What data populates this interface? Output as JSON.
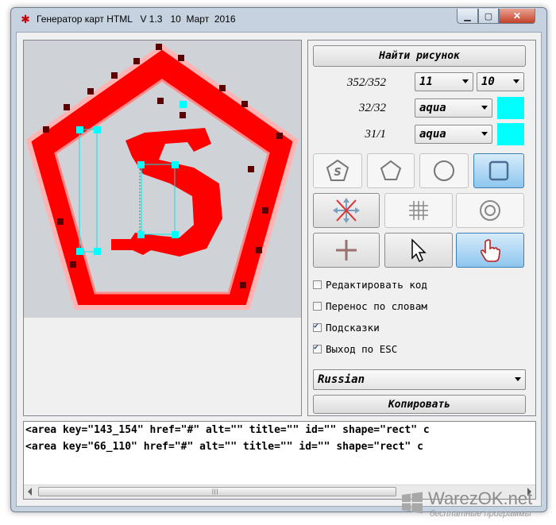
{
  "window": {
    "title": "Генератор карт HTML   V 1.3   10  Март  2016",
    "minimize_glyph": "▁",
    "maximize_glyph": "▢",
    "close_glyph": "✕"
  },
  "toolbar": {
    "find_image_label": "Найти рисунок",
    "copy_label": "Копировать"
  },
  "info_rows": [
    {
      "label": "352/352",
      "combo1": "11",
      "combo2": "10"
    },
    {
      "label": "32/32",
      "color_name": "aqua",
      "swatch_color": "#00ffff"
    },
    {
      "label": "31/1",
      "color_name": "aqua",
      "swatch_color": "#00ffff"
    }
  ],
  "checkboxes": [
    {
      "label": "Редактировать код",
      "checked": false
    },
    {
      "label": "Перенос по словам",
      "checked": false
    },
    {
      "label": "Подсказки",
      "checked": true
    },
    {
      "label": "Выход по ESC",
      "checked": true
    }
  ],
  "language": "Russian",
  "code_lines": [
    "<area key=\"143_154\" href=\"#\" alt=\"\" title=\"\" id=\"\" shape=\"rect\" c",
    "<area key=\"66_110\" href=\"#\" alt=\"\" title=\"\" id=\"\" shape=\"rect\" c"
  ],
  "watermark": {
    "title": "WarezOK.net",
    "subtitle": "бесплатные программы"
  },
  "colors": {
    "accent_active": "#8ec6ef",
    "shape_red": "#ff0000",
    "handle_aqua": "#00ffff"
  }
}
